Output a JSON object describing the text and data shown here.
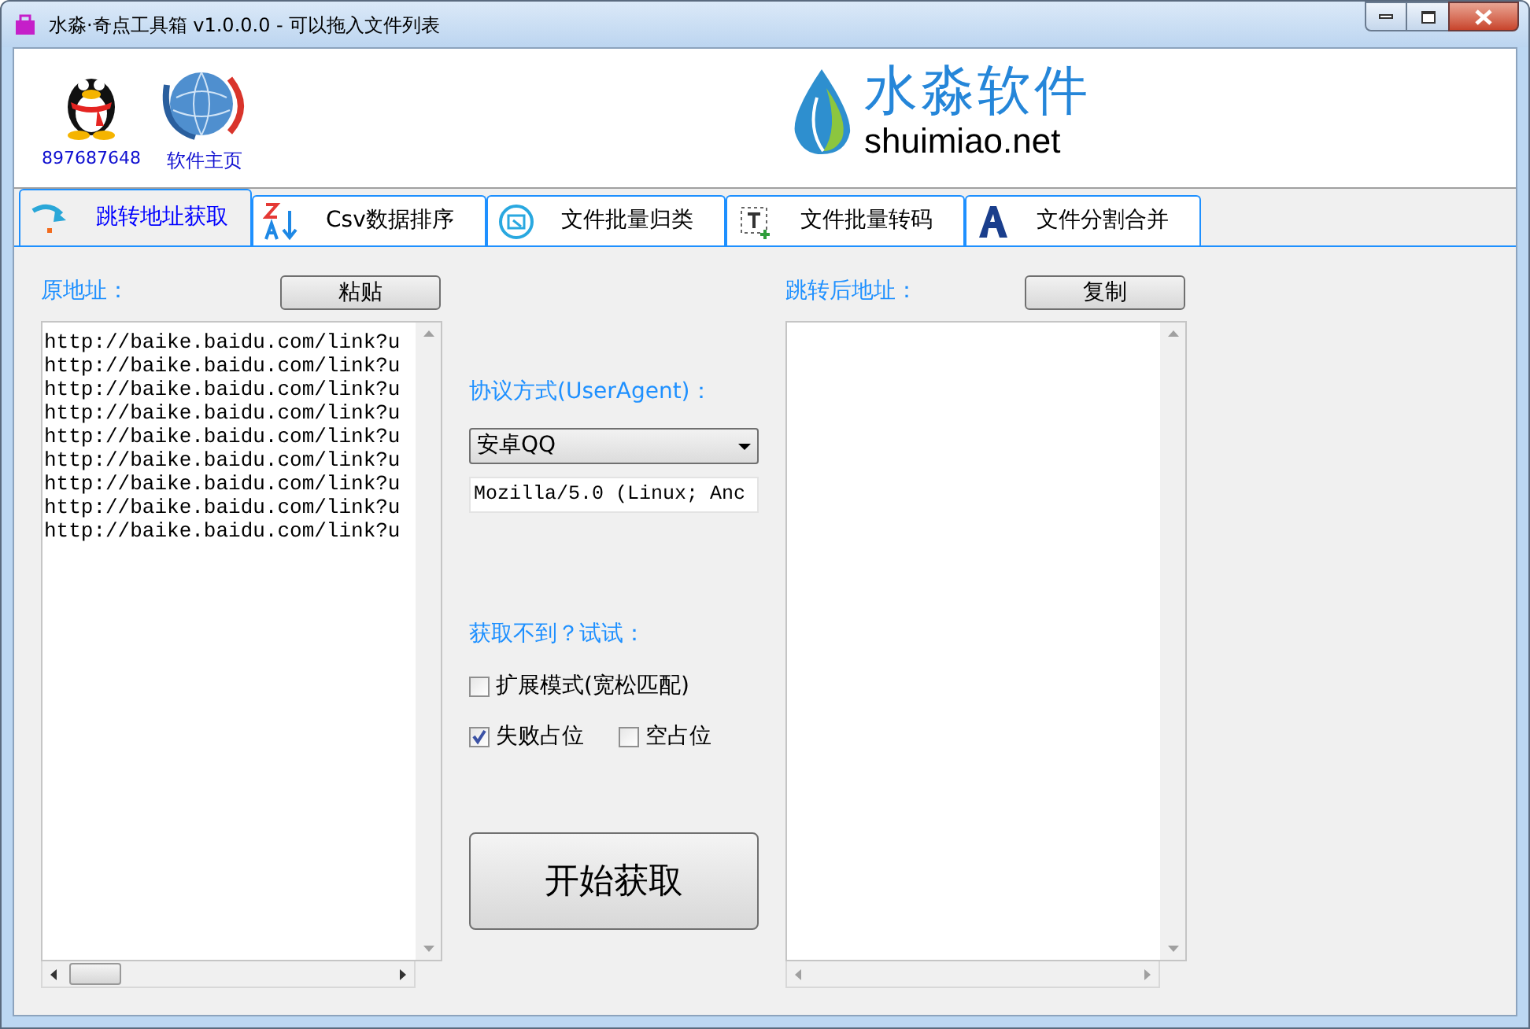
{
  "window": {
    "title": "水淼·奇点工具箱 v1.0.0.0 - 可以拖入文件列表"
  },
  "header": {
    "links": [
      {
        "kind": "qq",
        "label": "897687648"
      },
      {
        "kind": "home",
        "label": "软件主页"
      }
    ],
    "logo": {
      "name": "水淼软件",
      "domain": "shuimiao.net"
    }
  },
  "tabs": [
    {
      "kind": "redirect",
      "label": "跳转地址获取",
      "selected": true
    },
    {
      "kind": "sort",
      "label": "Csv数据排序",
      "selected": false
    },
    {
      "kind": "classify",
      "label": "文件批量归类",
      "selected": false
    },
    {
      "kind": "encode",
      "label": "文件批量转码",
      "selected": false
    },
    {
      "kind": "split",
      "label": "文件分割合并",
      "selected": false
    }
  ],
  "source": {
    "label": "原地址：",
    "button": "粘贴",
    "lines": [
      "http://baike.baidu.com/link?u",
      "http://baike.baidu.com/link?u",
      "http://baike.baidu.com/link?u",
      "http://baike.baidu.com/link?u",
      "http://baike.baidu.com/link?u",
      "http://baike.baidu.com/link?u",
      "http://baike.baidu.com/link?u",
      "http://baike.baidu.com/link?u",
      "http://baike.baidu.com/link?u"
    ]
  },
  "options": {
    "agent_label": "协议方式(UserAgent)：",
    "agent_select": "安卓QQ",
    "agent_string": "Mozilla/5.0 (Linux; Anc",
    "fallback_label": "获取不到？试试：",
    "checkboxes": [
      {
        "label": "扩展模式(宽松匹配)",
        "checked": false
      },
      {
        "label": "失败占位",
        "checked": true
      },
      {
        "label": "空占位",
        "checked": false
      }
    ],
    "start_button": "开始获取"
  },
  "result": {
    "label": "跳转后地址：",
    "button": "复制"
  }
}
